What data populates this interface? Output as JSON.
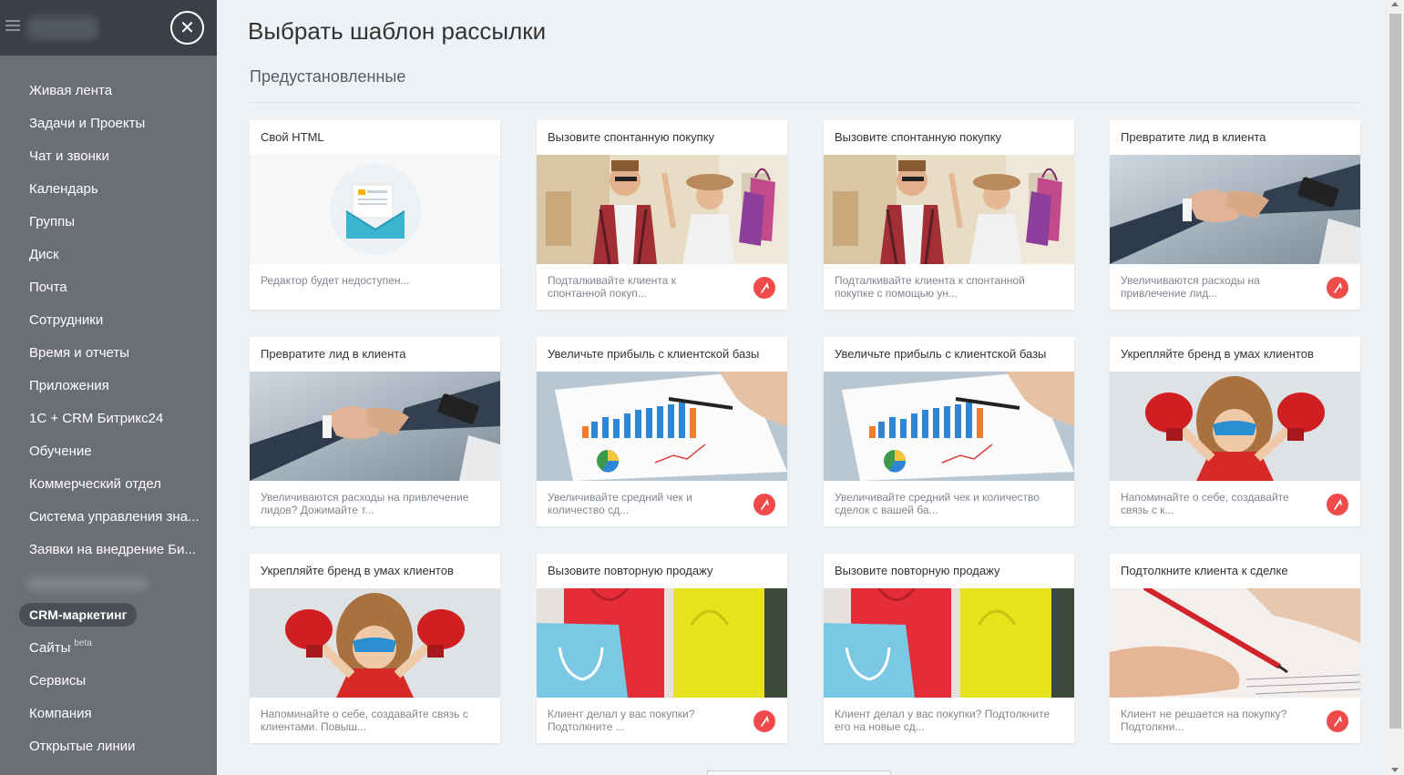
{
  "sidebar": {
    "close_label": "✕",
    "items": [
      {
        "label": "Живая лента"
      },
      {
        "label": "Задачи и Проекты"
      },
      {
        "label": "Чат и звонки"
      },
      {
        "label": "Календарь"
      },
      {
        "label": "Группы"
      },
      {
        "label": "Диск"
      },
      {
        "label": "Почта"
      },
      {
        "label": "Сотрудники"
      },
      {
        "label": "Время и отчеты"
      },
      {
        "label": "Приложения"
      },
      {
        "label": "1С + CRM Битрикс24"
      },
      {
        "label": "Обучение"
      },
      {
        "label": "Коммерческий отдел"
      },
      {
        "label": "Система управления зна..."
      },
      {
        "label": "Заявки на внедрение Би..."
      },
      {
        "label": "CRM-маркетинг"
      },
      {
        "label": "Сайты",
        "badge": "beta"
      },
      {
        "label": "Сервисы"
      },
      {
        "label": "Компания"
      },
      {
        "label": "Открытые линии"
      }
    ]
  },
  "main": {
    "title": "Выбрать шаблон рассылки",
    "section": "Предустановленные"
  },
  "cards": [
    {
      "title": "Свой HTML",
      "desc": "Редактор будет недоступен...",
      "image": "envelope-icon",
      "badge": false
    },
    {
      "title": "Вызовите спонтанную покупку",
      "desc": "Подталкивайте клиента к спонтанной покуп...",
      "image": "shopping-couple",
      "badge": true
    },
    {
      "title": "Вызовите спонтанную покупку",
      "desc": "Подталкивайте клиента к спонтанной покупке с помощью ун...",
      "image": "shopping-couple",
      "badge": false
    },
    {
      "title": "Превратите лид в клиента",
      "desc": "Увеличиваются расходы на привлечение лид...",
      "image": "handshake",
      "badge": true
    },
    {
      "title": "Превратите лид в клиента",
      "desc": "Увеличиваются расходы на привлечение лидов? Дожимайте т...",
      "image": "handshake",
      "badge": false
    },
    {
      "title": "Увеличьте прибыль с клиентской базы",
      "desc": "Увеличивайте средний чек и количество сд...",
      "image": "chart-paper",
      "badge": true
    },
    {
      "title": "Увеличьте прибыль с клиентской базы",
      "desc": "Увеличивайте средний чек и количество сделок с вашей ба...",
      "image": "chart-paper",
      "badge": false
    },
    {
      "title": "Укрепляйте бренд в умах клиентов",
      "desc": "Напоминайте о себе, создавайте связь с к...",
      "image": "hero-kid",
      "badge": true
    },
    {
      "title": "Укрепляйте бренд в умах клиентов",
      "desc": "Напоминайте о себе, создавайте связь с клиентами. Повыш...",
      "image": "hero-kid",
      "badge": false
    },
    {
      "title": "Вызовите повторную продажу",
      "desc": "Клиент делал у вас покупки? Подтолкните ...",
      "image": "shopping-bags",
      "badge": true
    },
    {
      "title": "Вызовите повторную продажу",
      "desc": "Клиент делал у вас покупки? Подтолкните его на новые сд...",
      "image": "shopping-bags",
      "badge": false
    },
    {
      "title": "Подтолкните клиента к сделке",
      "desc": "Клиент не решается на покупку? Подтолкни...",
      "image": "signing-pen",
      "badge": true
    }
  ]
}
